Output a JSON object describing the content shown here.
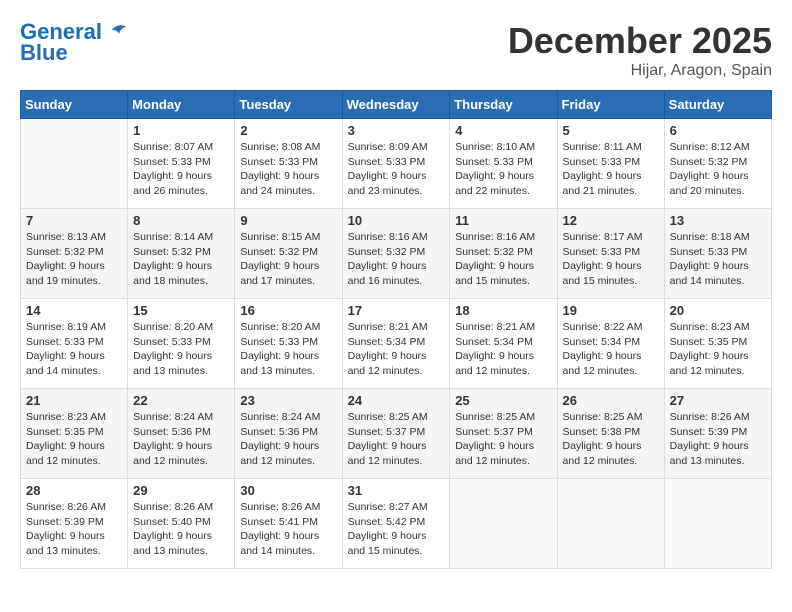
{
  "header": {
    "logo_line1": "General",
    "logo_line2": "Blue",
    "month_title": "December 2025",
    "location": "Hijar, Aragon, Spain"
  },
  "weekdays": [
    "Sunday",
    "Monday",
    "Tuesday",
    "Wednesday",
    "Thursday",
    "Friday",
    "Saturday"
  ],
  "weeks": [
    [
      {
        "day": "",
        "info": ""
      },
      {
        "day": "1",
        "info": "Sunrise: 8:07 AM\nSunset: 5:33 PM\nDaylight: 9 hours\nand 26 minutes."
      },
      {
        "day": "2",
        "info": "Sunrise: 8:08 AM\nSunset: 5:33 PM\nDaylight: 9 hours\nand 24 minutes."
      },
      {
        "day": "3",
        "info": "Sunrise: 8:09 AM\nSunset: 5:33 PM\nDaylight: 9 hours\nand 23 minutes."
      },
      {
        "day": "4",
        "info": "Sunrise: 8:10 AM\nSunset: 5:33 PM\nDaylight: 9 hours\nand 22 minutes."
      },
      {
        "day": "5",
        "info": "Sunrise: 8:11 AM\nSunset: 5:33 PM\nDaylight: 9 hours\nand 21 minutes."
      },
      {
        "day": "6",
        "info": "Sunrise: 8:12 AM\nSunset: 5:32 PM\nDaylight: 9 hours\nand 20 minutes."
      }
    ],
    [
      {
        "day": "7",
        "info": "Sunrise: 8:13 AM\nSunset: 5:32 PM\nDaylight: 9 hours\nand 19 minutes."
      },
      {
        "day": "8",
        "info": "Sunrise: 8:14 AM\nSunset: 5:32 PM\nDaylight: 9 hours\nand 18 minutes."
      },
      {
        "day": "9",
        "info": "Sunrise: 8:15 AM\nSunset: 5:32 PM\nDaylight: 9 hours\nand 17 minutes."
      },
      {
        "day": "10",
        "info": "Sunrise: 8:16 AM\nSunset: 5:32 PM\nDaylight: 9 hours\nand 16 minutes."
      },
      {
        "day": "11",
        "info": "Sunrise: 8:16 AM\nSunset: 5:32 PM\nDaylight: 9 hours\nand 15 minutes."
      },
      {
        "day": "12",
        "info": "Sunrise: 8:17 AM\nSunset: 5:33 PM\nDaylight: 9 hours\nand 15 minutes."
      },
      {
        "day": "13",
        "info": "Sunrise: 8:18 AM\nSunset: 5:33 PM\nDaylight: 9 hours\nand 14 minutes."
      }
    ],
    [
      {
        "day": "14",
        "info": "Sunrise: 8:19 AM\nSunset: 5:33 PM\nDaylight: 9 hours\nand 14 minutes."
      },
      {
        "day": "15",
        "info": "Sunrise: 8:20 AM\nSunset: 5:33 PM\nDaylight: 9 hours\nand 13 minutes."
      },
      {
        "day": "16",
        "info": "Sunrise: 8:20 AM\nSunset: 5:33 PM\nDaylight: 9 hours\nand 13 minutes."
      },
      {
        "day": "17",
        "info": "Sunrise: 8:21 AM\nSunset: 5:34 PM\nDaylight: 9 hours\nand 12 minutes."
      },
      {
        "day": "18",
        "info": "Sunrise: 8:21 AM\nSunset: 5:34 PM\nDaylight: 9 hours\nand 12 minutes."
      },
      {
        "day": "19",
        "info": "Sunrise: 8:22 AM\nSunset: 5:34 PM\nDaylight: 9 hours\nand 12 minutes."
      },
      {
        "day": "20",
        "info": "Sunrise: 8:23 AM\nSunset: 5:35 PM\nDaylight: 9 hours\nand 12 minutes."
      }
    ],
    [
      {
        "day": "21",
        "info": "Sunrise: 8:23 AM\nSunset: 5:35 PM\nDaylight: 9 hours\nand 12 minutes."
      },
      {
        "day": "22",
        "info": "Sunrise: 8:24 AM\nSunset: 5:36 PM\nDaylight: 9 hours\nand 12 minutes."
      },
      {
        "day": "23",
        "info": "Sunrise: 8:24 AM\nSunset: 5:36 PM\nDaylight: 9 hours\nand 12 minutes."
      },
      {
        "day": "24",
        "info": "Sunrise: 8:25 AM\nSunset: 5:37 PM\nDaylight: 9 hours\nand 12 minutes."
      },
      {
        "day": "25",
        "info": "Sunrise: 8:25 AM\nSunset: 5:37 PM\nDaylight: 9 hours\nand 12 minutes."
      },
      {
        "day": "26",
        "info": "Sunrise: 8:25 AM\nSunset: 5:38 PM\nDaylight: 9 hours\nand 12 minutes."
      },
      {
        "day": "27",
        "info": "Sunrise: 8:26 AM\nSunset: 5:39 PM\nDaylight: 9 hours\nand 13 minutes."
      }
    ],
    [
      {
        "day": "28",
        "info": "Sunrise: 8:26 AM\nSunset: 5:39 PM\nDaylight: 9 hours\nand 13 minutes."
      },
      {
        "day": "29",
        "info": "Sunrise: 8:26 AM\nSunset: 5:40 PM\nDaylight: 9 hours\nand 13 minutes."
      },
      {
        "day": "30",
        "info": "Sunrise: 8:26 AM\nSunset: 5:41 PM\nDaylight: 9 hours\nand 14 minutes."
      },
      {
        "day": "31",
        "info": "Sunrise: 8:27 AM\nSunset: 5:42 PM\nDaylight: 9 hours\nand 15 minutes."
      },
      {
        "day": "",
        "info": ""
      },
      {
        "day": "",
        "info": ""
      },
      {
        "day": "",
        "info": ""
      }
    ]
  ]
}
